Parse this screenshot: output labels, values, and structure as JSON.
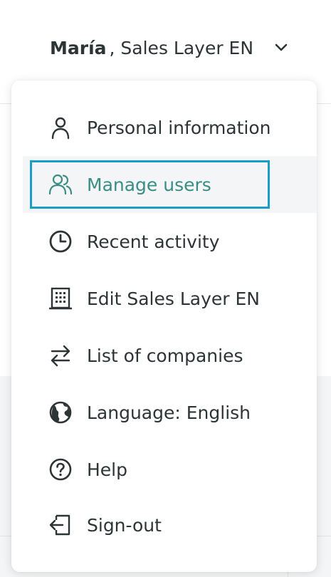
{
  "account": {
    "user": "María",
    "company": ", Sales Layer EN"
  },
  "menu": {
    "items": [
      {
        "label": "Personal information",
        "icon": "user-icon"
      },
      {
        "label": "Manage users",
        "icon": "users-icon",
        "active": true
      },
      {
        "label": "Recent activity",
        "icon": "clock-icon"
      },
      {
        "label": "Edit Sales Layer EN",
        "icon": "building-icon"
      },
      {
        "label": "List of companies",
        "icon": "swap-arrows-icon"
      },
      {
        "label": "Language: English",
        "icon": "globe-icon"
      },
      {
        "label": "Help",
        "icon": "question-circle-icon"
      },
      {
        "label": "Sign-out",
        "icon": "sign-out-icon"
      }
    ]
  },
  "colors": {
    "accent": "#3a8d84",
    "focus": "#1a9dc8",
    "text": "#2d3436",
    "hover_bg": "#f4f5f6"
  }
}
